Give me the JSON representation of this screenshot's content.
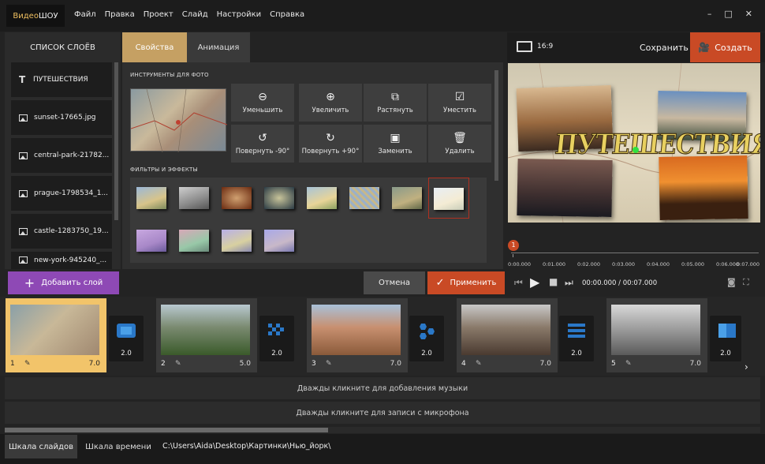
{
  "app": {
    "logo_part1": "Видео",
    "logo_part2": "ШОУ"
  },
  "menu": [
    "Файл",
    "Правка",
    "Проект",
    "Слайд",
    "Настройки",
    "Справка"
  ],
  "window_controls": [
    "–",
    "□",
    "✕"
  ],
  "layers": {
    "title": "СПИСОК СЛОЁВ",
    "items": [
      {
        "label": "ПУТЕШЕСТВИЯ",
        "type": "text"
      },
      {
        "label": "sunset-17665.jpg",
        "type": "image"
      },
      {
        "label": "central-park-21782...",
        "type": "image"
      },
      {
        "label": "prague-1798534_1...",
        "type": "image"
      },
      {
        "label": "castle-1283750_19...",
        "type": "image"
      },
      {
        "label": "new-york-945240_...",
        "type": "image"
      }
    ],
    "add_button": "Добавить слой"
  },
  "tabs": {
    "properties": "Свойства",
    "animation": "Анимация"
  },
  "properties": {
    "photo_tools_title": "ИНСТРУМЕНТЫ ДЛЯ ФОТО",
    "tools": [
      {
        "label": "Уменьшить",
        "icon": "zoom-out-icon"
      },
      {
        "label": "Увеличить",
        "icon": "zoom-in-icon"
      },
      {
        "label": "Растянуть",
        "icon": "stretch-icon"
      },
      {
        "label": "Уместить",
        "icon": "fit-icon"
      },
      {
        "label": "Повернуть -90°",
        "icon": "rotate-left-icon"
      },
      {
        "label": "Повернуть +90°",
        "icon": "rotate-right-icon"
      },
      {
        "label": "Заменить",
        "icon": "replace-image-icon"
      },
      {
        "label": "Удалить",
        "icon": "trash-icon"
      }
    ],
    "filters_title": "ФИЛЬТРЫ И ЭФФЕКТЫ",
    "filter_count": 12,
    "selected_filter_index": 7
  },
  "actions": {
    "cancel": "Отмена",
    "apply": "Применить"
  },
  "preview": {
    "aspect": "16:9",
    "save": "Сохранить",
    "create": "Создать",
    "title_text": "ПУТЕШЕСТВИЯ",
    "ruler_labels": [
      "0:00.000",
      "0:01.000",
      "0:02.000",
      "0:03.000",
      "0:04.000",
      "0:05.000",
      "0:06.000",
      "0:07.000"
    ],
    "playhead_marker": "1",
    "time": "00:00.000 / 00:07.000"
  },
  "slides": [
    {
      "num": "1",
      "duration": "7.0",
      "selected": true
    },
    {
      "num": "2",
      "duration": "5.0",
      "selected": false
    },
    {
      "num": "3",
      "duration": "7.0",
      "selected": false
    },
    {
      "num": "4",
      "duration": "7.0",
      "selected": false
    },
    {
      "num": "5",
      "duration": "7.0",
      "selected": false
    }
  ],
  "transitions": [
    {
      "duration": "2.0"
    },
    {
      "duration": "2.0"
    },
    {
      "duration": "2.0"
    },
    {
      "duration": "2.0"
    },
    {
      "duration": "2.0"
    }
  ],
  "audio": {
    "music_hint": "Дважды кликните для добавления музыки",
    "mic_hint": "Дважды кликните для записи с микрофона"
  },
  "footer": {
    "tab_slides": "Шкала слайдов",
    "tab_timeline": "Шкала времени",
    "path": "C:\\Users\\Aida\\Desktop\\Картинки\\Нью_йорк\\"
  },
  "colors": {
    "accent": "#c5a063",
    "create": "#c94a25",
    "add_layer": "#8e49b5"
  }
}
